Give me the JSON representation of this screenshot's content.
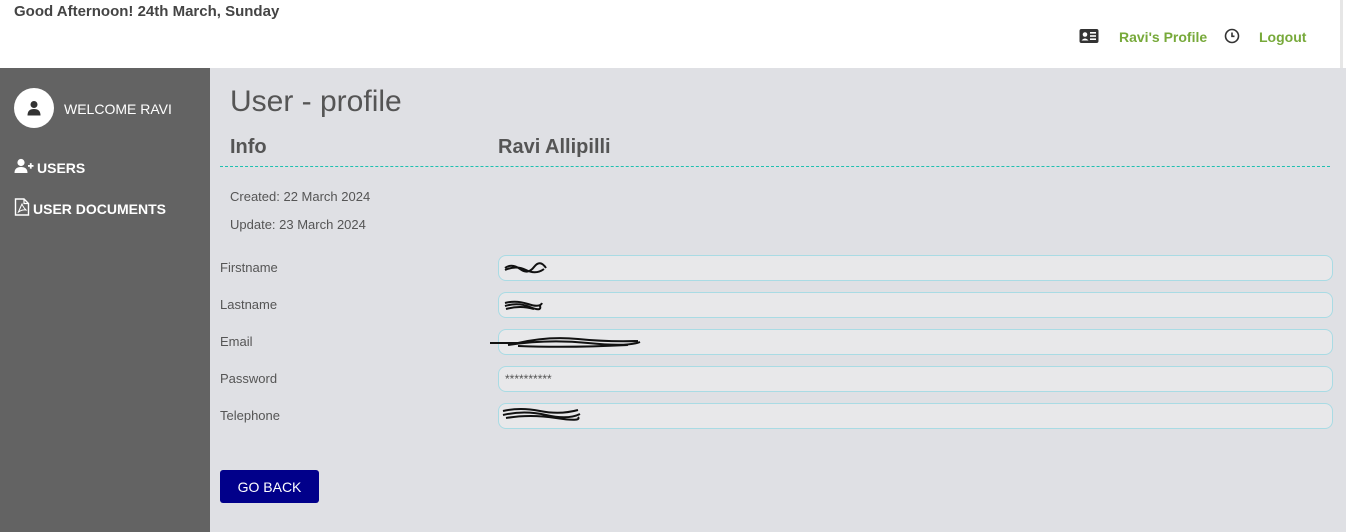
{
  "header": {
    "greeting": "Good Afternoon! 24th March, Sunday",
    "profile_link": "Ravi's Profile",
    "logout_link": "Logout"
  },
  "sidebar": {
    "welcome": "WELCOME RAVI",
    "items": [
      {
        "label": "USERS",
        "icon": "user-plus-icon"
      },
      {
        "label": "USER DOCUMENTS",
        "icon": "pdf-file-icon"
      }
    ]
  },
  "main": {
    "title": "User - profile",
    "info_label": "Info",
    "user_name": "Ravi Allipilli",
    "created": "Created: 22 March 2024",
    "updated": "Update: 23 March 2024",
    "fields": [
      {
        "label": "Firstname",
        "value": ""
      },
      {
        "label": "Lastname",
        "value": ""
      },
      {
        "label": "Email",
        "value": ""
      },
      {
        "label": "Password",
        "value": "**********"
      },
      {
        "label": "Telephone",
        "value": ""
      }
    ],
    "go_back_label": "GO BACK"
  },
  "colors": {
    "link": "#77a93a",
    "sidebar_bg": "#636363",
    "main_bg": "#dfe0e4",
    "button_bg": "#01008a",
    "divider": "#20c0b0"
  }
}
